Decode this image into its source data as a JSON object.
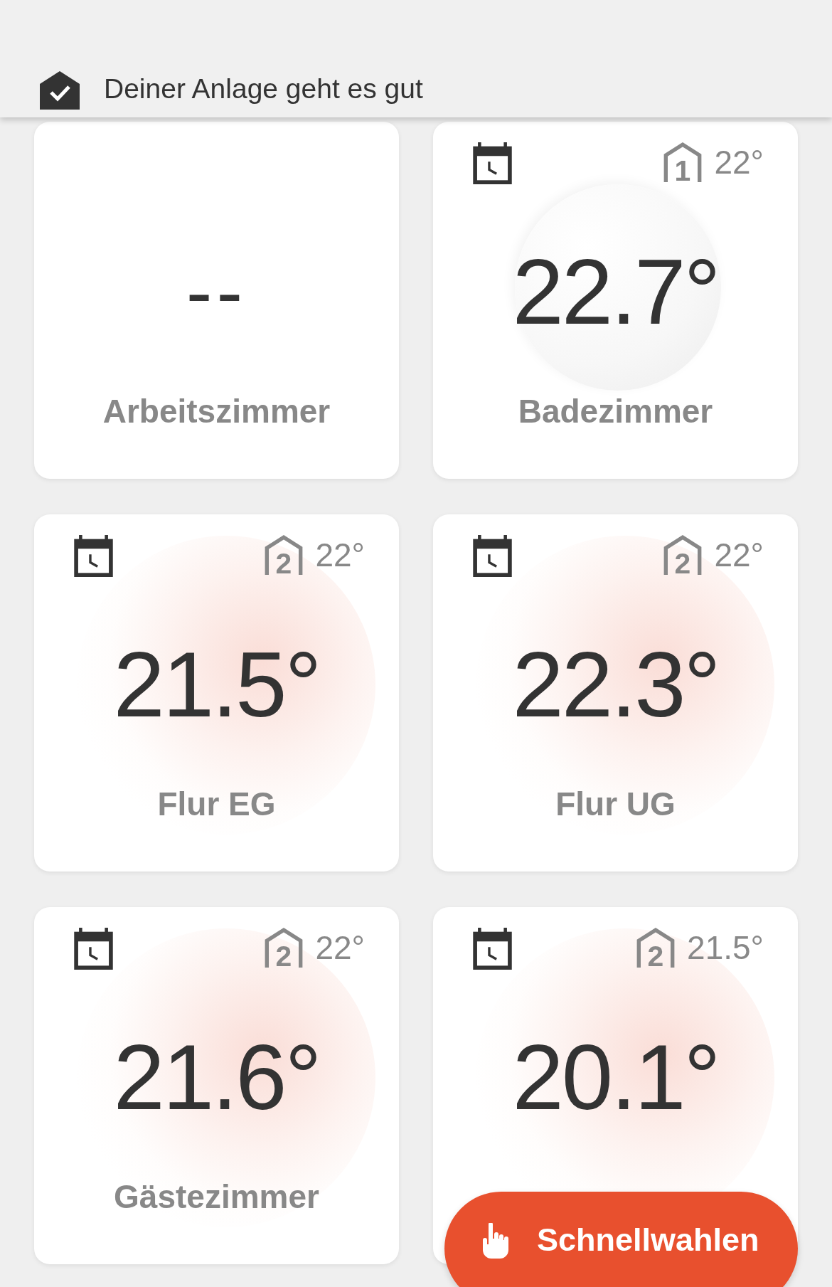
{
  "header": {
    "status": "Deiner Anlage geht es gut",
    "ok": true
  },
  "room_rows": [
    {
      "rooms": [
        {
          "kind": "empty",
          "reading": "--",
          "name": "Arbeitszimmer"
        },
        {
          "kind": "active",
          "schedule": true,
          "zone": "1",
          "setpoint": "22°",
          "reading": "22.7°",
          "heating": false,
          "name": "Badezimmer"
        }
      ]
    },
    {
      "rooms": [
        {
          "kind": "active",
          "schedule": true,
          "zone": "2",
          "setpoint": "22°",
          "reading": "21.5°",
          "heating": true,
          "name": "Flur EG"
        },
        {
          "kind": "active",
          "schedule": true,
          "zone": "2",
          "setpoint": "22°",
          "reading": "22.3°",
          "heating": true,
          "name": "Flur UG"
        }
      ]
    },
    {
      "rooms": [
        {
          "kind": "active",
          "schedule": true,
          "zone": "2",
          "setpoint": "22°",
          "reading": "21.6°",
          "heating": true,
          "name": "Gästezimmer"
        },
        {
          "kind": "active",
          "schedule": true,
          "zone": "2",
          "setpoint": "21.5°",
          "reading": "20.1°",
          "heating": true
        }
      ]
    }
  ],
  "quick_button": {
    "label": "Schnellwahlen"
  }
}
